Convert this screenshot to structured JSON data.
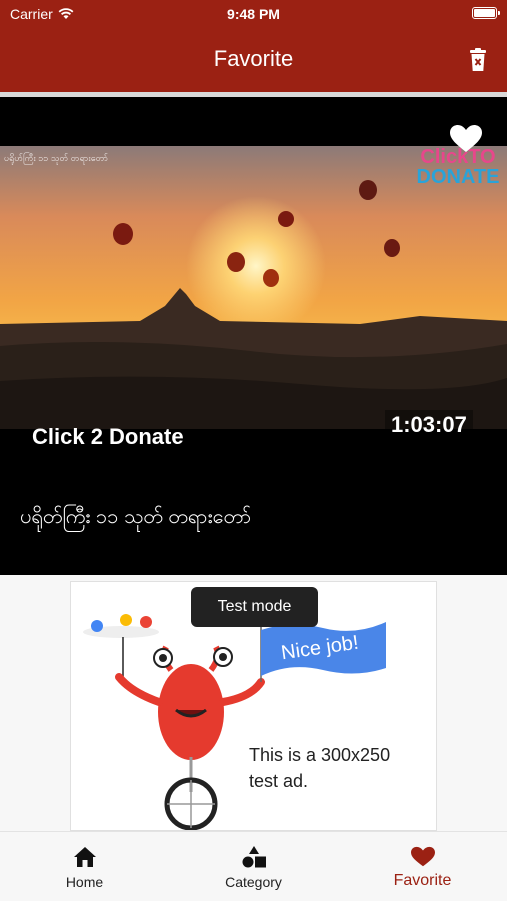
{
  "status_bar": {
    "carrier": "Carrier",
    "time": "9:48 PM",
    "battery_level": 1.0
  },
  "nav": {
    "title": "Favorite",
    "trash_icon": "trash-icon"
  },
  "video": {
    "small_overlay_text": "ပရိုဟ်ကြီး ၁၁ သုတ် တရားတော်",
    "logo_line1": "ClickTO",
    "logo_line2": "DONATE",
    "duration": "1:03:07",
    "channel": "Click 2 Donate",
    "title": "ပရိုတ်ကြီး ၁၁ သုတ် တရားတော်",
    "favorite_icon": "heart-icon"
  },
  "ad": {
    "tooltip": "Test mode",
    "banner": "Nice job!",
    "text_line1": "This is a 300x250",
    "text_line2": "test ad."
  },
  "tabs": [
    {
      "label": "Home",
      "icon": "home-icon"
    },
    {
      "label": "Category",
      "icon": "category-icon"
    },
    {
      "label": "Favorite",
      "icon": "heart-icon"
    }
  ],
  "colors": {
    "brand": "#9b2113",
    "active_tab": "#9b2113"
  }
}
